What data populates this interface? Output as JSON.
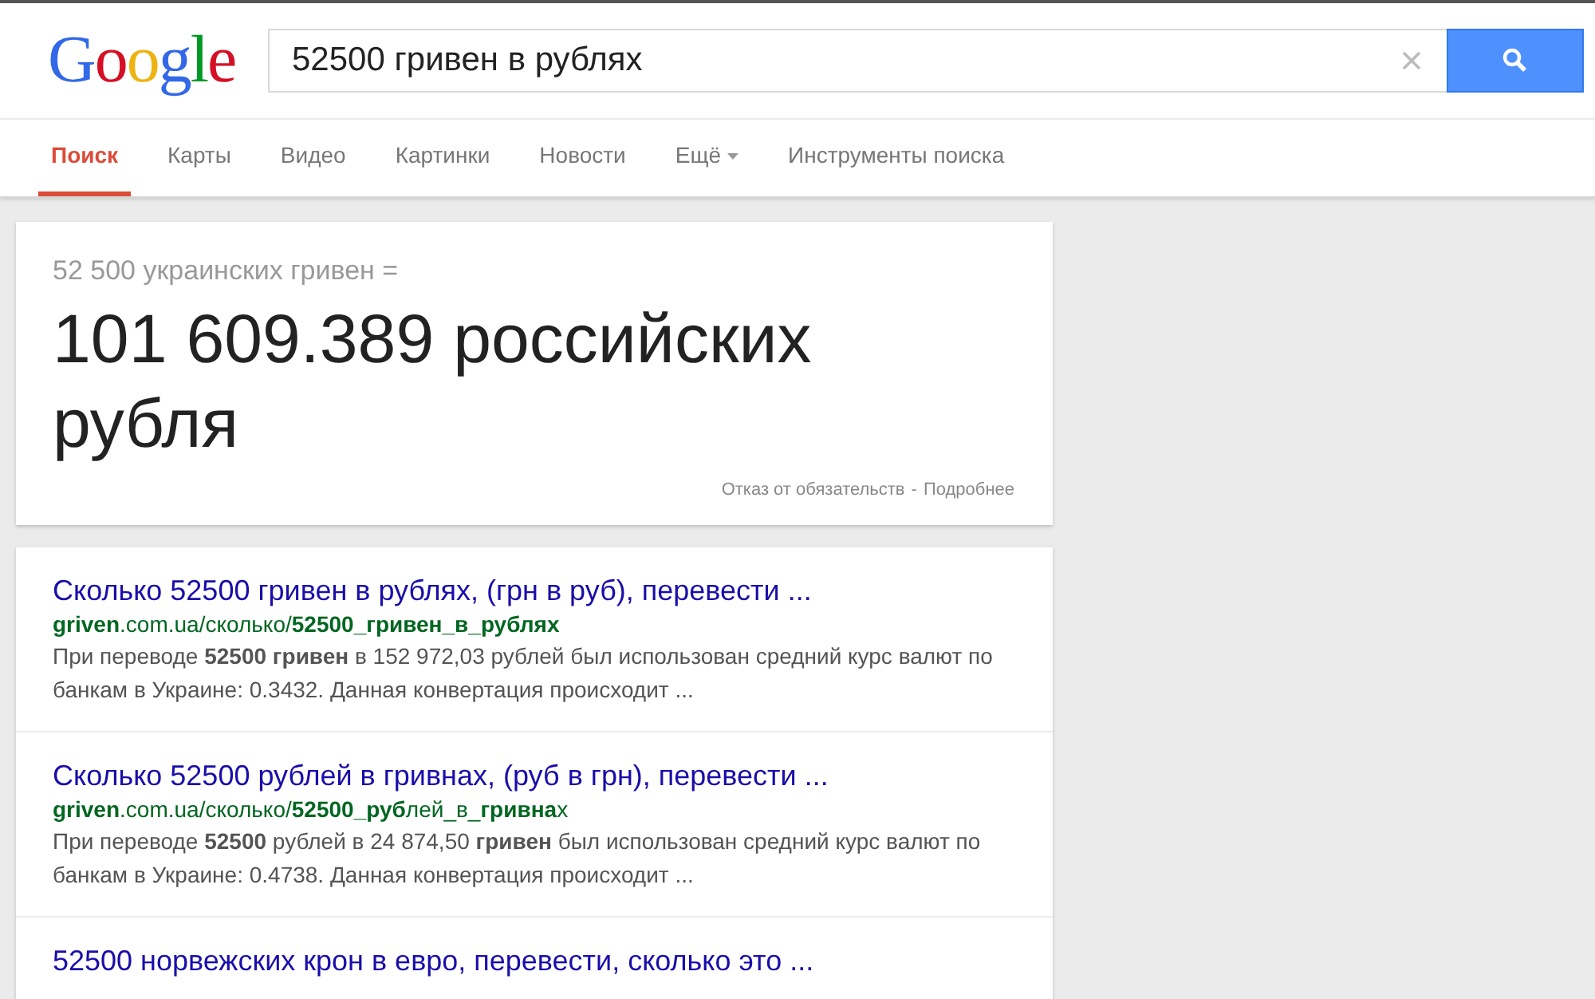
{
  "logo": "Google",
  "search": {
    "value": "52500 гривен в рублях"
  },
  "tabs": [
    {
      "label": "Поиск",
      "selected": true
    },
    {
      "label": "Карты",
      "selected": false
    },
    {
      "label": "Видео",
      "selected": false
    },
    {
      "label": "Картинки",
      "selected": false
    },
    {
      "label": "Новости",
      "selected": false
    },
    {
      "label": "Ещё",
      "selected": false,
      "kind": "dropdown"
    },
    {
      "label": "Инструменты поиска",
      "selected": false
    }
  ],
  "converter": {
    "source": "52 500 украинских гривен =",
    "result": "101 609.389 российских рубля",
    "disclaimer": "Отказ от обязательств",
    "separator": "-",
    "more": "Подробнее"
  },
  "results": [
    {
      "title": "Сколько 52500 гривен в рублях, (грн в руб), перевести ...",
      "url": "**griven**.com.ua/сколько/**52500_гривен_в_рублях**",
      "snippet": "При переводе **52500 гривен** в 152 972,03 рублей был использован средний курс валют по банкам в Украине: 0.3432. Данная конвертация происходит ..."
    },
    {
      "title": "Сколько 52500 рублей в гривнах, (руб в грн), перевести ...",
      "url": "**griven**.com.ua/сколько/**52500_руб**лей_в_**гривна**х",
      "snippet": "При переводе **52500** рублей в 24 874,50 **гривен** был использован средний курс валют по банкам в Украине: 0.4738. Данная конвертация происходит ..."
    },
    {
      "title": "52500 норвежских крон в евро, перевести, сколько это ..."
    }
  ]
}
